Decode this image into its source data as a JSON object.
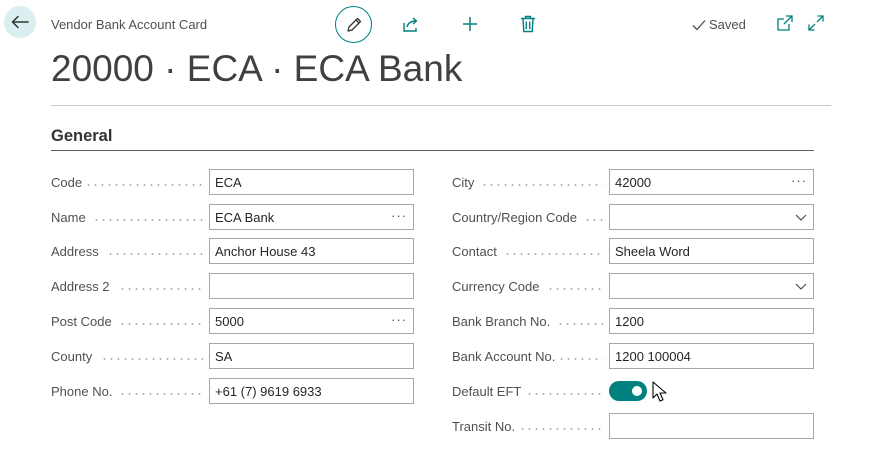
{
  "header": {
    "caption": "Vendor Bank Account Card",
    "saved_label": "Saved",
    "title": "20000 · ECA · ECA Bank"
  },
  "toolbar": {
    "back_icon": "arrow-left-icon",
    "edit_icon": "pencil-icon",
    "share_icon": "share-icon",
    "new_icon": "plus-icon",
    "delete_icon": "trash-icon",
    "popout_icon": "open-new-window-icon",
    "expand_icon": "expand-icon"
  },
  "section": {
    "title": "General"
  },
  "left_fields": [
    {
      "label": "Code",
      "value": "ECA",
      "control": "text"
    },
    {
      "label": "Name",
      "value": "ECA Bank",
      "control": "lookup"
    },
    {
      "label": "Address",
      "value": "Anchor House 43",
      "control": "text"
    },
    {
      "label": "Address 2",
      "value": "",
      "control": "text"
    },
    {
      "label": "Post Code",
      "value": "5000",
      "control": "lookup"
    },
    {
      "label": "County",
      "value": "SA",
      "control": "text"
    },
    {
      "label": "Phone No.",
      "value": "+61 (7) 9619 6933",
      "control": "text"
    }
  ],
  "right_fields": [
    {
      "label": "City",
      "value": "42000",
      "control": "lookup"
    },
    {
      "label": "Country/Region Code",
      "value": "",
      "control": "dropdown"
    },
    {
      "label": "Contact",
      "value": "Sheela Word",
      "control": "text"
    },
    {
      "label": "Currency Code",
      "value": "",
      "control": "dropdown"
    },
    {
      "label": "Bank Branch No.",
      "value": "1200",
      "control": "text"
    },
    {
      "label": "Bank Account No.",
      "value": "1200 100004",
      "control": "text"
    },
    {
      "label": "Default EFT",
      "value": true,
      "control": "toggle"
    },
    {
      "label": "Transit No.",
      "value": "",
      "control": "text"
    }
  ],
  "colors": {
    "accent": "#00807f",
    "back_button_bg": "#dceff0"
  }
}
